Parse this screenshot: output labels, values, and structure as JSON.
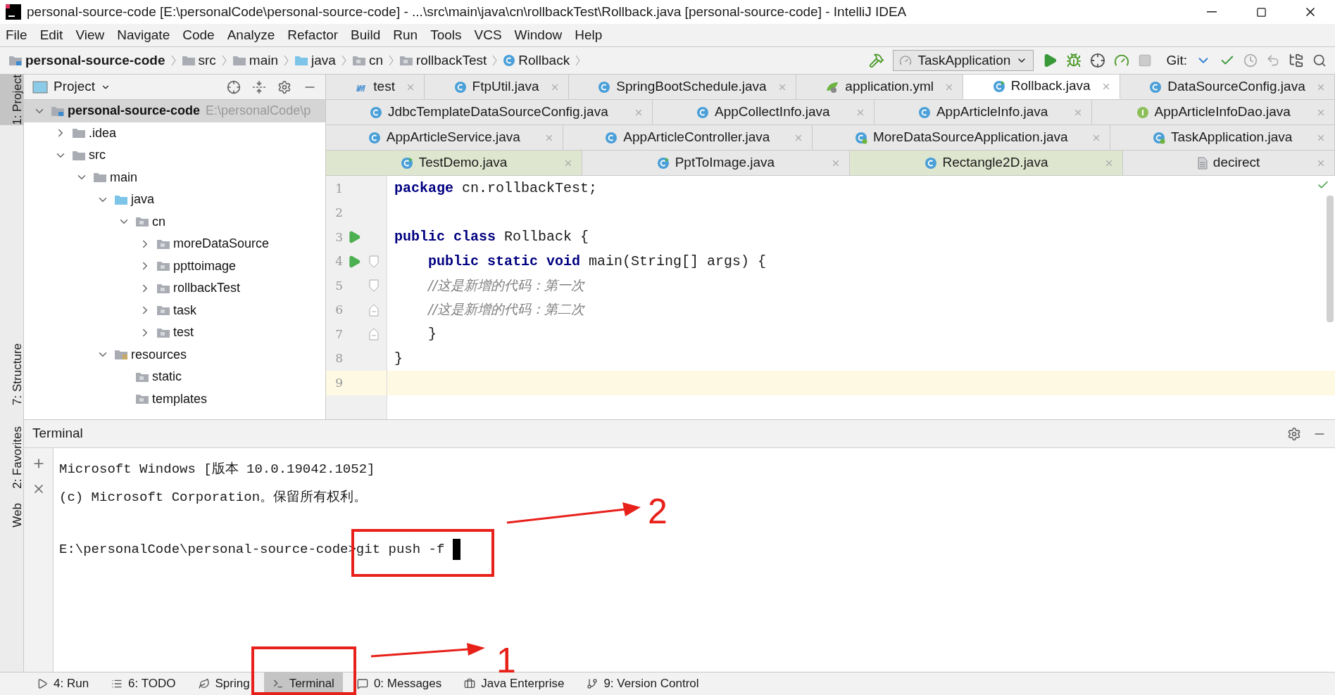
{
  "window": {
    "title": "personal-source-code [E:\\personalCode\\personal-source-code] - ...\\src\\main\\java\\cn\\rollbackTest\\Rollback.java [personal-source-code] - IntelliJ IDEA"
  },
  "menu": [
    "File",
    "Edit",
    "View",
    "Navigate",
    "Code",
    "Analyze",
    "Refactor",
    "Build",
    "Run",
    "Tools",
    "VCS",
    "Window",
    "Help"
  ],
  "breadcrumbs": [
    {
      "label": "personal-source-code",
      "kind": "module"
    },
    {
      "label": "src",
      "kind": "folder"
    },
    {
      "label": "main",
      "kind": "folder"
    },
    {
      "label": "java",
      "kind": "source"
    },
    {
      "label": "cn",
      "kind": "package"
    },
    {
      "label": "rollbackTest",
      "kind": "package"
    },
    {
      "label": "Rollback",
      "kind": "class"
    }
  ],
  "toolbar": {
    "run_config": "TaskApplication",
    "git_label": "Git:"
  },
  "side_tools": [
    {
      "label": "1: Project",
      "selected": true
    },
    {
      "label": "7: Structure",
      "selected": false
    },
    {
      "label": "2: Favorites",
      "selected": false
    },
    {
      "label": "Web",
      "selected": false
    }
  ],
  "project": {
    "title": "Project",
    "tree": [
      {
        "label": "personal-source-code",
        "path": "E:\\personalCode\\p",
        "kind": "module",
        "expanded": true,
        "children": [
          {
            "label": ".idea",
            "kind": "folder",
            "expanded": false
          },
          {
            "label": "src",
            "kind": "folder",
            "expanded": true,
            "children": [
              {
                "label": "main",
                "kind": "folder",
                "expanded": true,
                "children": [
                  {
                    "label": "java",
                    "kind": "source",
                    "expanded": true,
                    "children": [
                      {
                        "label": "cn",
                        "kind": "package",
                        "expanded": true,
                        "children": [
                          {
                            "label": "moreDataSource",
                            "kind": "package",
                            "expanded": false
                          },
                          {
                            "label": "ppttoimage",
                            "kind": "package",
                            "expanded": false
                          },
                          {
                            "label": "rollbackTest",
                            "kind": "package",
                            "expanded": false
                          },
                          {
                            "label": "task",
                            "kind": "package",
                            "expanded": false
                          },
                          {
                            "label": "test",
                            "kind": "package",
                            "expanded": false
                          }
                        ]
                      }
                    ]
                  },
                  {
                    "label": "resources",
                    "kind": "resources",
                    "expanded": true,
                    "children": [
                      {
                        "label": "static",
                        "kind": "package"
                      },
                      {
                        "label": "templates",
                        "kind": "package"
                      }
                    ]
                  }
                ]
              }
            ]
          }
        ]
      }
    ]
  },
  "tab_rows": [
    [
      {
        "label": "test",
        "kind": "module",
        "selected": false,
        "color": "#e8e8e8"
      },
      {
        "label": "FtpUtil.java",
        "kind": "class",
        "selected": false,
        "color": "#e8e8e8"
      },
      {
        "label": "SpringBootSchedule.java",
        "kind": "class",
        "selected": false,
        "color": "#e8e8e8"
      },
      {
        "label": "application.yml",
        "kind": "yaml",
        "selected": false,
        "color": "#e8e8e8"
      },
      {
        "label": "Rollback.java",
        "kind": "runnable",
        "selected": true,
        "color": "#ffffff"
      },
      {
        "label": "DataSourceConfig.java",
        "kind": "class",
        "selected": false,
        "color": "#e8e8e8"
      }
    ],
    [
      {
        "label": "JdbcTemplateDataSourceConfig.java",
        "kind": "class",
        "selected": false,
        "color": "#e8e8e8"
      },
      {
        "label": "AppCollectInfo.java",
        "kind": "class",
        "selected": false,
        "color": "#e8e8e8"
      },
      {
        "label": "AppArticleInfo.java",
        "kind": "class",
        "selected": false,
        "color": "#e8e8e8"
      },
      {
        "label": "AppArticleInfoDao.java",
        "kind": "interface",
        "selected": false,
        "color": "#e8e8e8"
      }
    ],
    [
      {
        "label": "AppArticleService.java",
        "kind": "class",
        "selected": false,
        "color": "#e8e8e8"
      },
      {
        "label": "AppArticleController.java",
        "kind": "class",
        "selected": false,
        "color": "#e8e8e8"
      },
      {
        "label": "MoreDataSourceApplication.java",
        "kind": "spring",
        "selected": false,
        "color": "#e8e8e8"
      },
      {
        "label": "TaskApplication.java",
        "kind": "spring",
        "selected": false,
        "color": "#e8e8e8"
      }
    ],
    [
      {
        "label": "TestDemo.java",
        "kind": "runnable",
        "selected": false,
        "color": "#dfe6cf"
      },
      {
        "label": "PptToImage.java",
        "kind": "runnable",
        "selected": false,
        "color": "#e8e8e8"
      },
      {
        "label": "Rectangle2D.java",
        "kind": "class",
        "selected": false,
        "color": "#dfe6cf"
      },
      {
        "label": "decirect",
        "kind": "file",
        "selected": false,
        "color": "#e8e8e8"
      }
    ]
  ],
  "code": [
    {
      "number": "1",
      "run": false,
      "fold_start": false,
      "fold_end": false,
      "current": false,
      "tokens": [
        {
          "kind": "keyword",
          "text": "package"
        },
        {
          "kind": "plain",
          "text": " cn.rollbackTest;"
        }
      ]
    },
    {
      "number": "2",
      "run": false,
      "fold_start": false,
      "fold_end": false,
      "current": false
    },
    {
      "number": "3",
      "run": true,
      "fold_start": false,
      "fold_end": false,
      "current": false,
      "tokens": [
        {
          "kind": "keyword",
          "text": "public class"
        },
        {
          "kind": "plain",
          "text": " Rollback {"
        }
      ]
    },
    {
      "number": "4",
      "run": true,
      "fold_start": true,
      "fold_end": false,
      "current": false,
      "tokens": [
        {
          "kind": "keyword",
          "text": "    public static void"
        },
        {
          "kind": "plain",
          "text": " main(String[] args) {"
        }
      ]
    },
    {
      "number": "5",
      "run": false,
      "fold_start": true,
      "fold_end": false,
      "current": false,
      "tokens": [
        {
          "kind": "comment",
          "text": "        //这是新增的代码：第一次"
        }
      ]
    },
    {
      "number": "6",
      "run": false,
      "fold_start": false,
      "fold_end": true,
      "current": false,
      "tokens": [
        {
          "kind": "comment",
          "text": "        //这是新增的代码：第二次"
        }
      ]
    },
    {
      "number": "7",
      "run": false,
      "fold_start": false,
      "fold_end": true,
      "current": false,
      "tokens": [
        {
          "kind": "plain",
          "text": "    }"
        }
      ]
    },
    {
      "number": "8",
      "run": false,
      "fold_start": false,
      "fold_end": false,
      "current": false,
      "tokens": [
        {
          "kind": "plain",
          "text": "}"
        }
      ]
    },
    {
      "number": "9",
      "run": false,
      "fold_start": false,
      "fold_end": false,
      "current": true
    }
  ],
  "terminal": {
    "title": "Terminal",
    "lines": [
      {
        "kind": "output",
        "text": "Microsoft Windows [版本 10.0.19042.1052]"
      },
      {
        "kind": "output",
        "text": "(c) Microsoft Corporation。保留所有权利。"
      },
      {
        "kind": "prompt",
        "text": "E:\\personalCode\\personal-source-code>git push -f "
      }
    ]
  },
  "bottom_tools": [
    {
      "label": "4: Run",
      "kind": "run",
      "selected": false
    },
    {
      "label": "6: TODO",
      "kind": "list",
      "selected": false
    },
    {
      "label": "Spring",
      "kind": "leaf",
      "selected": false
    },
    {
      "label": "Terminal",
      "kind": "terminal",
      "selected": true
    },
    {
      "label": "0: Messages",
      "kind": "messages",
      "selected": false
    },
    {
      "label": "Java Enterprise",
      "kind": "enterprise",
      "selected": false
    },
    {
      "label": "9: Version Control",
      "kind": "vcs",
      "selected": false
    }
  ],
  "annotations": [
    {
      "label": "2"
    },
    {
      "label": "1"
    }
  ]
}
